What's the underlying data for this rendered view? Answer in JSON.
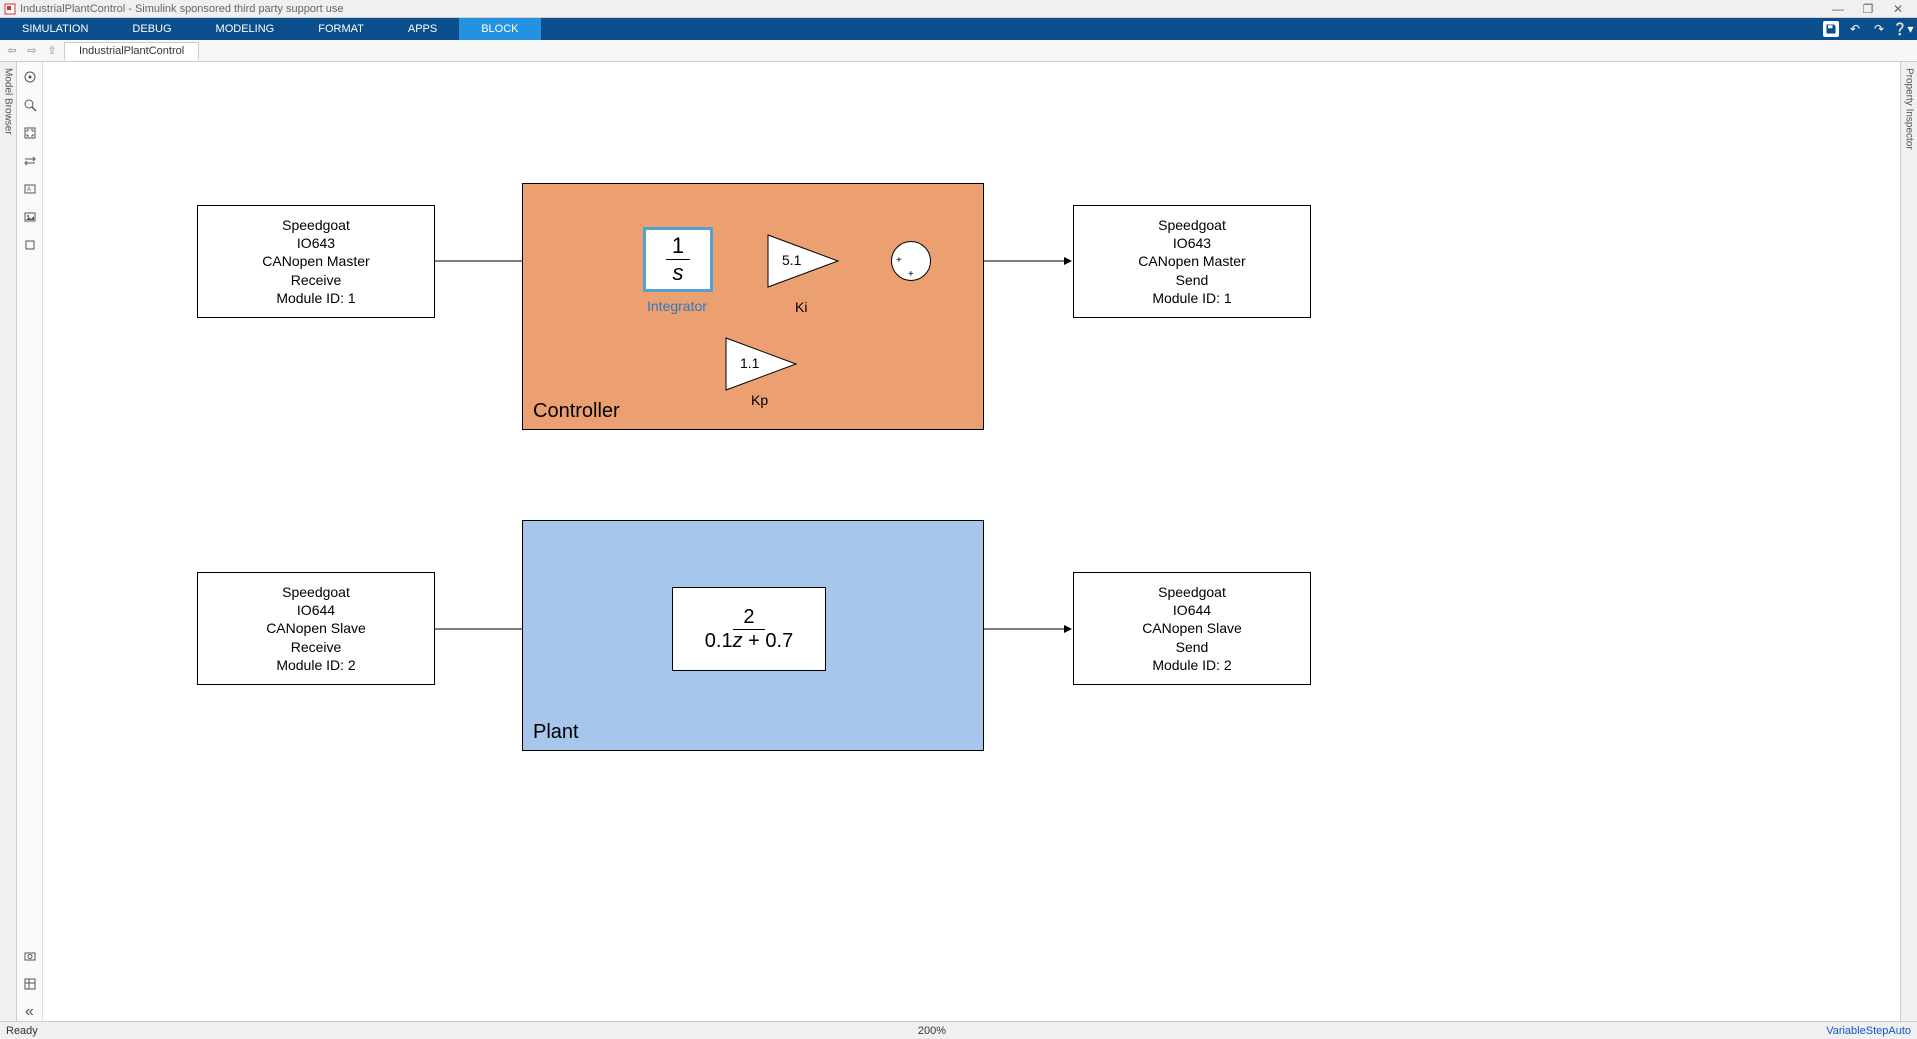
{
  "window": {
    "title": "IndustrialPlantControl - Simulink sponsored third party support use",
    "minimize": "—",
    "restore": "❐",
    "close": "✕"
  },
  "tabs": {
    "simulation": "SIMULATION",
    "debug": "DEBUG",
    "modeling": "MODELING",
    "format": "FORMAT",
    "apps": "APPS",
    "block": "BLOCK"
  },
  "breadcrumb": {
    "model": "IndustrialPlantControl"
  },
  "side_panels": {
    "left": "Model Browser",
    "right": "Property Inspector"
  },
  "diagram": {
    "master_receive": {
      "l1": "Speedgoat",
      "l2": "IO643",
      "l3": "CANopen Master",
      "l4": "Receive",
      "l5": "Module ID: 1"
    },
    "master_send": {
      "l1": "Speedgoat",
      "l2": "IO643",
      "l3": "CANopen Master",
      "l4": "Send",
      "l5": "Module ID: 1"
    },
    "slave_receive": {
      "l1": "Speedgoat",
      "l2": "IO644",
      "l3": "CANopen Slave",
      "l4": "Receive",
      "l5": "Module ID: 2"
    },
    "slave_send": {
      "l1": "Speedgoat",
      "l2": "IO644",
      "l3": "CANopen Slave",
      "l4": "Send",
      "l5": "Module ID: 2"
    },
    "controller_label": "Controller",
    "plant_label": "Plant",
    "integrator": {
      "num": "1",
      "den": "s",
      "label": "Integrator"
    },
    "ki": {
      "value": "5.1",
      "label": "Ki"
    },
    "kp": {
      "value": "1.1",
      "label": "Kp"
    },
    "tf": {
      "num": "2",
      "den_a": "0.1",
      "den_var": "z",
      "den_b": " + 0.7"
    }
  },
  "statusbar": {
    "ready": "Ready",
    "zoom": "200%",
    "solver": "VariableStepAuto"
  }
}
